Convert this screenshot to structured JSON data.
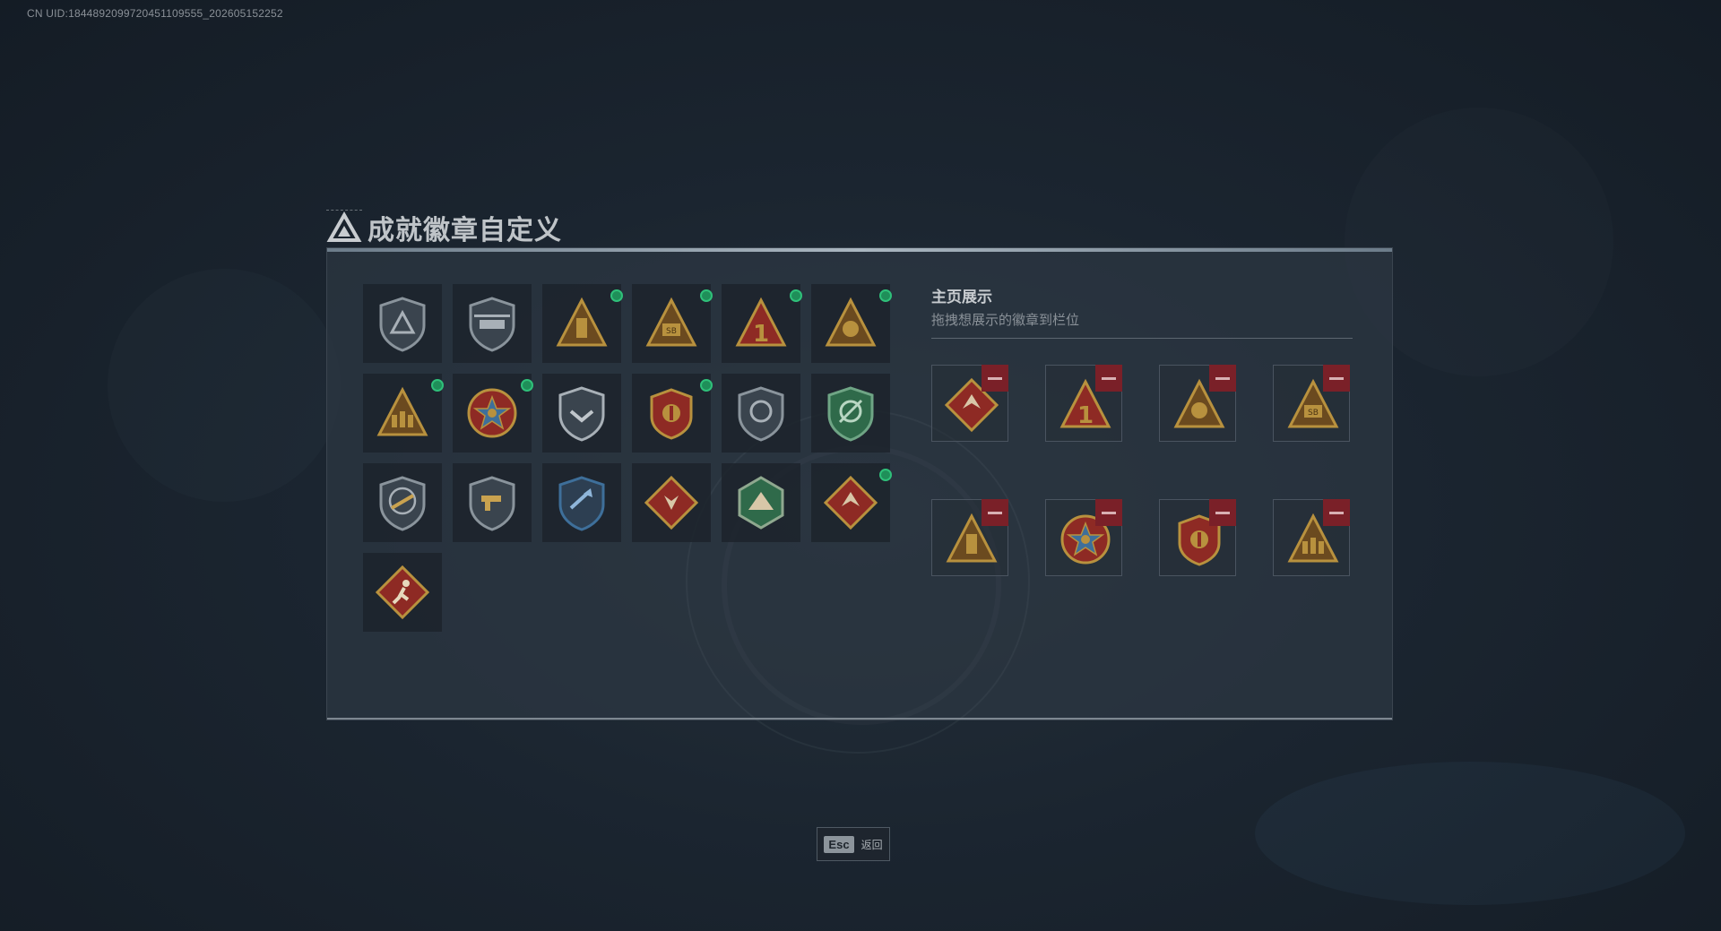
{
  "uid_text": "CN UID:1844892099720451109555_202605152252",
  "header": {
    "title": "成就徽章自定义"
  },
  "badges": [
    {
      "icon": "shield-triangle-badge-icon",
      "new": false
    },
    {
      "icon": "helicopter-shield-badge-icon",
      "new": false
    },
    {
      "icon": "tower-triangle-badge-icon",
      "new": true
    },
    {
      "icon": "sb-triangle-badge-icon",
      "new": true
    },
    {
      "icon": "number-one-triangle-badge-icon",
      "new": true
    },
    {
      "icon": "lion-triangle-badge-icon",
      "new": true
    },
    {
      "icon": "soldiers-triangle-badge-icon",
      "new": true
    },
    {
      "icon": "star-wreath-badge-icon",
      "new": true
    },
    {
      "icon": "chevron-shield-badge-icon",
      "new": false
    },
    {
      "icon": "eagle-crest-badge-icon",
      "new": true
    },
    {
      "icon": "lion-shield-badge-icon",
      "new": false
    },
    {
      "icon": "green-target-shield-badge-icon",
      "new": false
    },
    {
      "icon": "rifle-shield-badge-icon",
      "new": false
    },
    {
      "icon": "gun-shield-badge-icon",
      "new": false
    },
    {
      "icon": "blue-arrow-shield-badge-icon",
      "new": false
    },
    {
      "icon": "wolf-diamond-badge-icon",
      "new": false
    },
    {
      "icon": "dragon-hexagon-badge-icon",
      "new": false
    },
    {
      "icon": "dragon-diamond-badge-icon",
      "new": true
    },
    {
      "icon": "runner-diamond-badge-icon",
      "new": false
    }
  ],
  "showcase": {
    "title": "主页展示",
    "subtitle": "拖拽想展示的徽章到栏位",
    "slots": [
      {
        "icon": "dragon-diamond-badge-icon"
      },
      {
        "icon": "number-one-triangle-badge-icon"
      },
      {
        "icon": "lion-triangle-badge-icon"
      },
      {
        "icon": "sb-triangle-badge-icon"
      },
      {
        "icon": "tower-triangle-badge-icon"
      },
      {
        "icon": "star-wreath-badge-icon"
      },
      {
        "icon": "eagle-crest-badge-icon"
      },
      {
        "icon": "soldiers-triangle-badge-icon"
      }
    ]
  },
  "footer": {
    "esc_key": "Esc",
    "back_label": "返回"
  },
  "colors": {
    "new_dot": "#2fc07a",
    "remove": "#7a2028",
    "gold": "#b8913e",
    "red": "#8e2a24",
    "green": "#2f6a4a",
    "blue": "#3e6f9a"
  }
}
